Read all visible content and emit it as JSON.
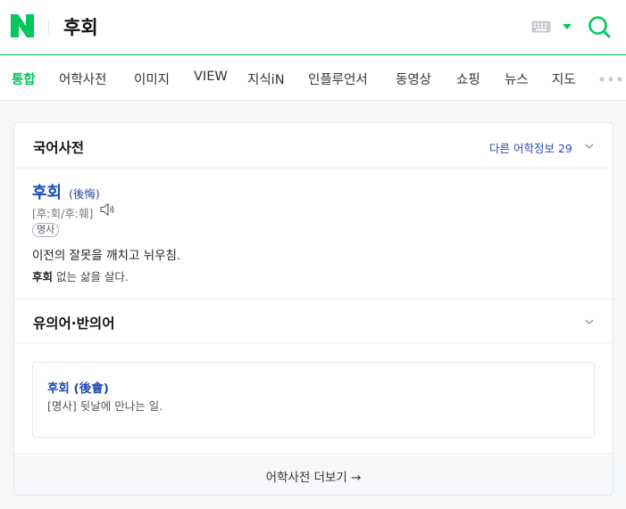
{
  "header": {
    "logo": "N",
    "query": "후회",
    "icons": [
      "keyboard-icon",
      "dropdown-arrow-icon",
      "search-icon"
    ]
  },
  "tabs": [
    {
      "label": "통합",
      "active": true
    },
    {
      "label": "어학사전"
    },
    {
      "label": "이미지"
    },
    {
      "label": "VIEW"
    },
    {
      "label": "지식iN"
    },
    {
      "label": "인플루언서"
    },
    {
      "label": "동영상"
    },
    {
      "label": "쇼핑"
    },
    {
      "label": "뉴스"
    },
    {
      "label": "지도"
    }
  ],
  "dictionary": {
    "title": "국어사전",
    "more_info": "다른 어학정보 29",
    "entry": {
      "word": "후회",
      "hanja": "(後悔)",
      "pronunciation": "[후ː회/후ː훼]",
      "pos": "명사",
      "meaning": "이전의 잘못을 깨치고 뉘우침.",
      "example_word": "후회",
      "example_rest": " 없는 삶을 살다."
    },
    "synonyms": {
      "title": "유의어·반의어",
      "word": "후회 (後會)",
      "definition": "[명사] 뒷날에 만나는 일."
    },
    "footer_link": "어학사전 더보기 →"
  },
  "colors": {
    "brand_green": "#03c75a",
    "link_blue": "#1f4bb4"
  }
}
